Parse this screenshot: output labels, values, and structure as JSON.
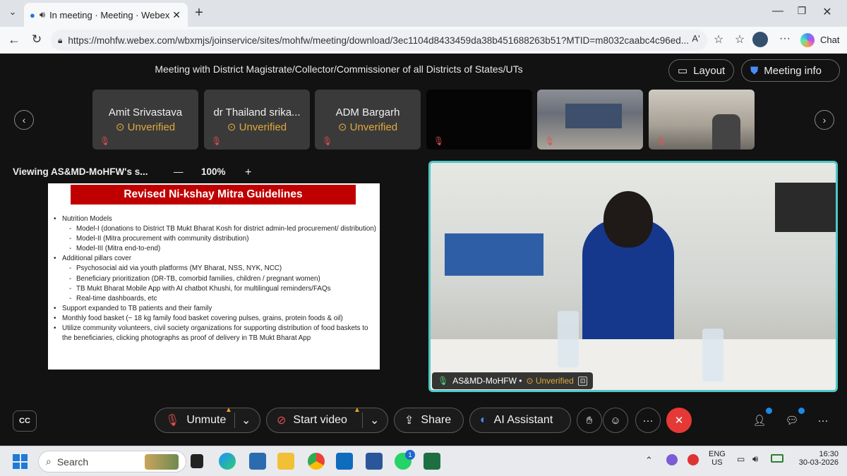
{
  "browser": {
    "tab_title": "In meeting · Meeting · Webex",
    "url": "https://mohfw.webex.com/wbxmjs/joinservice/sites/mohfw/meeting/download/3ec1104d8433459da38b451688263b51?MTID=m8032caabc4c96ed...",
    "chat_label": "Chat",
    "read_aloud": "Aʹ"
  },
  "meeting": {
    "title": "Meeting with District Magistrate/Collector/Commissioner of all Districts of States/UTs",
    "layout_label": "Layout",
    "info_label": "Meeting info",
    "participants": [
      {
        "name": "Amit Srivastava",
        "status": "Unverified"
      },
      {
        "name": "dr Thailand srika...",
        "status": "Unverified"
      },
      {
        "name": "ADM Bargarh",
        "status": "Unverified"
      }
    ],
    "viewing_label": "Viewing AS&MD-MoHFW's s...",
    "zoom": "100%",
    "zoom_minus": "—",
    "zoom_plus": "+",
    "speaker_name": "AS&MD-MoHFW •",
    "speaker_status": "Unverified"
  },
  "slide": {
    "title": "Revised Ni-kshay Mitra Guidelines",
    "items": [
      {
        "level": 1,
        "text": "Nutrition Models"
      },
      {
        "level": 2,
        "text": "Model-I (donations to District TB Mukt Bharat Kosh for district admin-led procurement/ distribution)"
      },
      {
        "level": 2,
        "text": "Model-II (Mitra procurement with community distribution)"
      },
      {
        "level": 2,
        "text": "Model-III (Mitra end-to-end)"
      },
      {
        "level": 1,
        "text": "Additional pillars cover"
      },
      {
        "level": 2,
        "text": "Psychosocial aid via youth platforms (MY Bharat, NSS, NYK, NCC)"
      },
      {
        "level": 2,
        "text": "Beneficiary prioritization (DR-TB, comorbid families, children / pregnant women)"
      },
      {
        "level": 2,
        "text": "TB Mukt Bharat Mobile App with AI chatbot Khushi, for multilingual reminders/FAQs"
      },
      {
        "level": 2,
        "text": "Real-time dashboards, etc"
      },
      {
        "level": 1,
        "text": "Support expanded to TB patients and their family"
      },
      {
        "level": 1,
        "text": "Monthly food basket (~ 18 kg family food basket covering pulses, grains, protein foods & oil)"
      },
      {
        "level": 1,
        "text": "Utilize community volunteers, civil society organizations for supporting distribution of food baskets to the beneficiaries, clicking photographs as proof of delivery in TB Mukt Bharat App"
      }
    ]
  },
  "controls": {
    "unmute": "Unmute",
    "start_video": "Start video",
    "share": "Share",
    "ai_assistant": "AI Assistant",
    "cc": "CC"
  },
  "taskbar": {
    "search_placeholder": "Search",
    "lang": "ENG",
    "region": "US",
    "time": "16:30",
    "date": "30-03-2026",
    "whatsapp_badge": "1"
  },
  "colors": {
    "accent_red": "#c00000",
    "leave_red": "#e53935",
    "video_border": "#4fc7c7",
    "unverified": "#e0a93a"
  }
}
